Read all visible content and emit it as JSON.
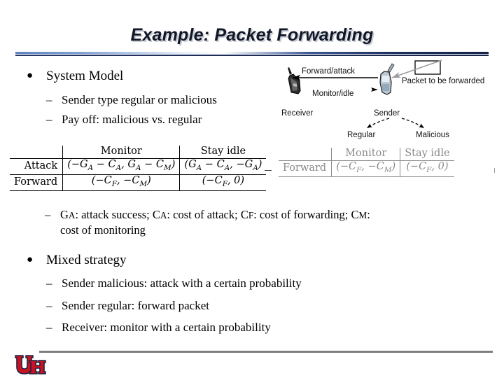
{
  "slide": {
    "title": "Example: Packet Forwarding",
    "accent_color": "#1b2a57",
    "title_color": "#101828"
  },
  "bullets": [
    {
      "marker": "●",
      "label": "System Model",
      "sub_marker": "–",
      "sub": [
        "Sender type regular or malicious",
        "Pay off: malicious vs. regular"
      ]
    },
    {
      "marker": "●",
      "label": "Mixed strategy",
      "sub_marker": "–",
      "sub": [
        "Sender malicious: attack with a certain probability",
        "Sender regular: forward packet",
        "Receiver: monitor with a certain probability"
      ]
    }
  ],
  "notation": {
    "marker": "–",
    "line1_parts": [
      {
        "sym": "G",
        "sub": "A",
        "text": ": attack success; "
      },
      {
        "sym": "C",
        "sub": "A",
        "text": ": cost of attack; "
      },
      {
        "sym": "C",
        "sub": "F",
        "text": ":  cost of forwarding; "
      },
      {
        "sym": "C",
        "sub": "M",
        "text": ":"
      }
    ],
    "line2": "cost of monitoring"
  },
  "matrix_left": {
    "color": "#000000",
    "corner": "",
    "columns": [
      "Monitor",
      "Stay idle"
    ],
    "rows": [
      {
        "label": "Attack",
        "cells": [
          {
            "open": "(−",
            "a_sym": "G",
            "a_sub": "A",
            "mid": " − ",
            "b_sym": "C",
            "b_sub": "A",
            "sep": ", ",
            "c_sym": "G",
            "c_sub": "A",
            "mid2": " − ",
            "d_sym": "C",
            "d_sub": "M",
            "close": ")"
          },
          {
            "open": "(",
            "a_sym": "G",
            "a_sub": "A",
            "mid": " − ",
            "b_sym": "C",
            "b_sub": "A",
            "sep": ", −",
            "c_sym": "G",
            "c_sub": "A",
            "close": ")"
          }
        ]
      },
      {
        "label": "Forward",
        "cells": [
          {
            "open": "(−",
            "a_sym": "C",
            "a_sub": "F",
            "sep": ", −",
            "c_sym": "C",
            "c_sub": "M",
            "close": ")"
          },
          {
            "open": "(−",
            "a_sym": "C",
            "a_sub": "F",
            "sep": ", ",
            "plain": "0",
            "close": ")"
          }
        ]
      }
    ]
  },
  "matrix_right": {
    "color": "#8a8a8a",
    "columns": [
      "Monitor",
      "Stay idle"
    ],
    "rows": [
      {
        "label": "Forward",
        "cells": [
          {
            "open": "(−",
            "a_sym": "C",
            "a_sub": "F",
            "sep": ", −",
            "c_sym": "C",
            "c_sub": "M",
            "close": ")"
          },
          {
            "open": "(−",
            "a_sym": "C",
            "a_sub": "F",
            "sep": ", ",
            "plain": "0",
            "close": ")"
          }
        ]
      }
    ]
  },
  "diagram": {
    "labels": {
      "forward_attack": "Forward/attack",
      "monitor_idle": "Monitor/idle",
      "receiver": "Receiver",
      "sender": "Sender",
      "packet": "Packet to be forwarded",
      "regular": "Regular",
      "malicious": "Malicious"
    }
  },
  "footer": {
    "logo_text": "UH",
    "logo_color": "#cc1122",
    "rule_color": "#808080"
  }
}
